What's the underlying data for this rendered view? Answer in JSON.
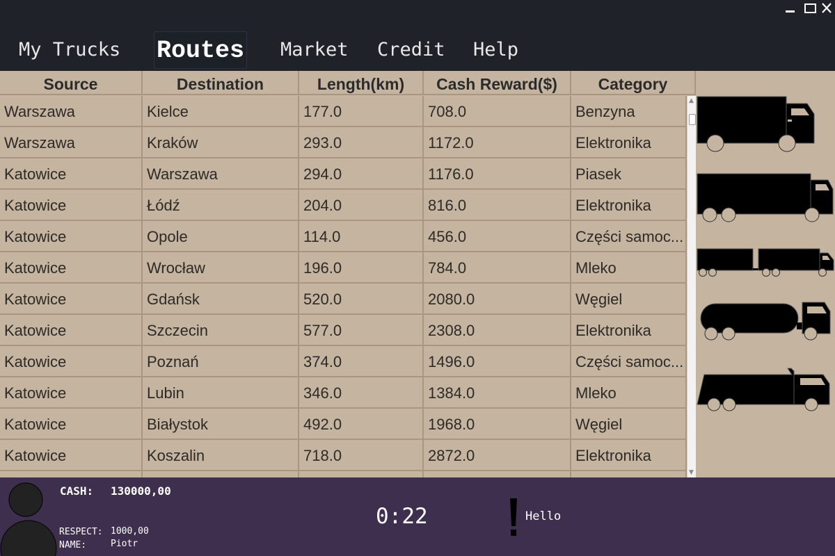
{
  "window": {
    "minimize_glyph": "",
    "maximize_glyph": "",
    "close_glyph": "✕"
  },
  "menu": {
    "tabs": [
      {
        "label": "My Trucks",
        "active": false
      },
      {
        "label": "Routes",
        "active": true
      },
      {
        "label": "Market",
        "active": false
      },
      {
        "label": "Credit",
        "active": false
      },
      {
        "label": "Help",
        "active": false
      }
    ]
  },
  "routes_table": {
    "columns": [
      "Source",
      "Destination",
      "Length(km)",
      "Cash Reward($)",
      "Category"
    ],
    "rows": [
      [
        "Warszawa",
        "Kielce",
        "177.0",
        "708.0",
        "Benzyna"
      ],
      [
        "Warszawa",
        "Kraków",
        "293.0",
        "1172.0",
        "Elektronika"
      ],
      [
        "Katowice",
        "Warszawa",
        "294.0",
        "1176.0",
        "Piasek"
      ],
      [
        "Katowice",
        "Łódź",
        "204.0",
        "816.0",
        "Elektronika"
      ],
      [
        "Katowice",
        "Opole",
        "114.0",
        "456.0",
        "Części samoc..."
      ],
      [
        "Katowice",
        "Wrocław",
        "196.0",
        "784.0",
        "Mleko"
      ],
      [
        "Katowice",
        "Gdańsk",
        "520.0",
        "2080.0",
        "Węgiel"
      ],
      [
        "Katowice",
        "Szczecin",
        "577.0",
        "2308.0",
        "Elektronika"
      ],
      [
        "Katowice",
        "Poznań",
        "374.0",
        "1496.0",
        "Części samoc..."
      ],
      [
        "Katowice",
        "Lubin",
        "346.0",
        "1384.0",
        "Mleko"
      ],
      [
        "Katowice",
        "Białystok",
        "492.0",
        "1968.0",
        "Węgiel"
      ],
      [
        "Katowice",
        "Koszalin",
        "718.0",
        "2872.0",
        "Elektronika"
      ],
      [
        "",
        "",
        "",
        "",
        ""
      ]
    ]
  },
  "trucks_panel": {
    "icons": [
      "box-truck-icon",
      "long-box-truck-icon",
      "truck-with-trailer-icon",
      "tanker-truck-icon",
      "dump-truck-icon"
    ]
  },
  "status": {
    "cash_label": "CASH:",
    "cash_value": "130000,00",
    "respect_label": "RESPECT:",
    "respect_value": "1000,00",
    "name_label": "NAME:",
    "name_value": "Piotr",
    "timer": "0:22",
    "message": "Hello"
  },
  "colors": {
    "table_bg": "#c4b4a0",
    "status_bg": "#3e2f4f",
    "app_bg": "#1f2329"
  }
}
